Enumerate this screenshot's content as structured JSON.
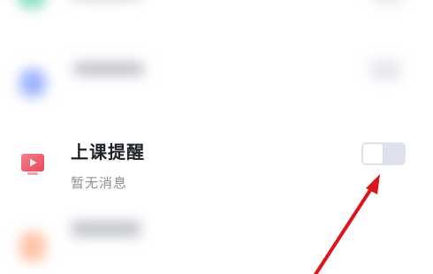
{
  "reminder": {
    "title": "上课提醒",
    "subtitle": "暂无消息",
    "toggle_state": "off",
    "icon": "tv-icon"
  },
  "colors": {
    "icon_red": "#ee5a6b",
    "toggle_track": "#dfe2ee",
    "arrow_red": "#d9161c",
    "title": "#1f2329",
    "subtitle": "#8a8f99"
  }
}
